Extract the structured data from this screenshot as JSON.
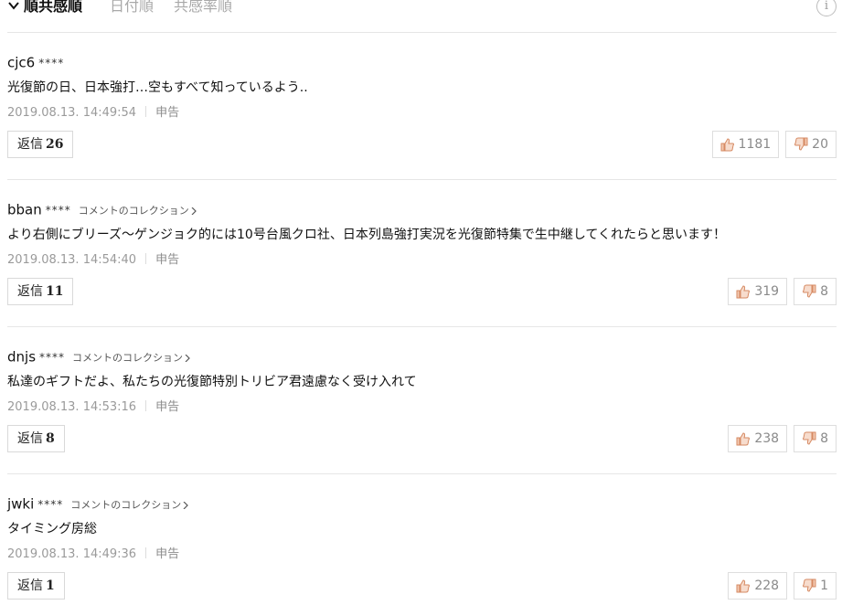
{
  "sort": {
    "active": "順共感順",
    "option2": "日付順",
    "option3": "共感率順",
    "info": "i"
  },
  "collection_label": "コメントのコレクション",
  "reply_label": "返信",
  "report_label": "申告",
  "colors": {
    "like": "#e9a27f",
    "dislike": "#e9a27f",
    "border": "#d9d9d9"
  },
  "comments": [
    {
      "user": "cjc6",
      "stars": "****",
      "text": "光復節の日、日本強打…空もすべて知っているよう..",
      "time": "2019.08.13. 14:49:54",
      "replies": "26",
      "likes": "1181",
      "dislikes": "20"
    },
    {
      "user": "bban",
      "stars": "****",
      "text": "より右側にブリーズ〜ゲンジョク的には10号台風クロ社、日本列島強打実況を光復節特集で生中継してくれたらと思います！",
      "time": "2019.08.13. 14:54:40",
      "replies": "11",
      "likes": "319",
      "dislikes": "8"
    },
    {
      "user": "dnjs",
      "stars": "****",
      "text": "私達のギフトだよ、私たちの光復節特別トリビア君遠慮なく受け入れて",
      "time": "2019.08.13. 14:53:16",
      "replies": "8",
      "likes": "238",
      "dislikes": "8"
    },
    {
      "user": "jwki",
      "stars": "****",
      "text": "タイミング房総",
      "time": "2019.08.13. 14:49:36",
      "replies": "1",
      "likes": "228",
      "dislikes": "1"
    }
  ]
}
